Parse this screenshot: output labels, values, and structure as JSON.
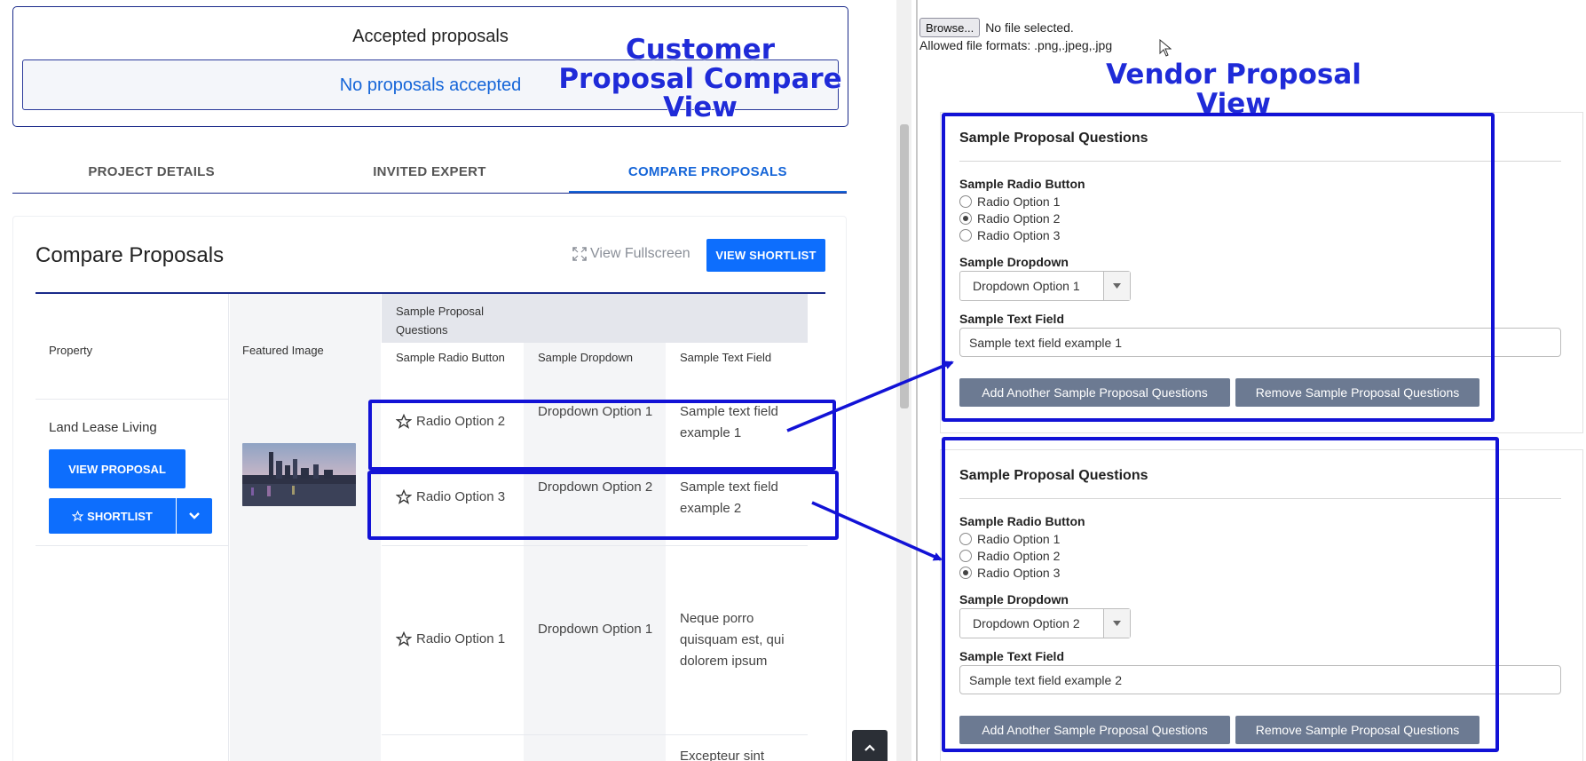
{
  "accepted": {
    "title": "Accepted proposals",
    "empty_message": "No proposals accepted"
  },
  "tabs": [
    {
      "label": "PROJECT DETAILS",
      "active": false
    },
    {
      "label": "INVITED EXPERT",
      "active": false
    },
    {
      "label": "COMPARE PROPOSALS",
      "active": true
    }
  ],
  "compare": {
    "title": "Compare Proposals",
    "view_fullscreen": "View Fullscreen",
    "view_shortlist": "VIEW SHORTLIST",
    "property_header": "Property",
    "featured_image_header": "Featured Image",
    "group_header": "Sample Proposal Questions",
    "question_headers": [
      "Sample Radio Button",
      "Sample Dropdown",
      "Sample Text Field"
    ],
    "property_name": "Land Lease Living",
    "view_proposal": "VIEW PROPOSAL",
    "shortlist": "SHORTLIST",
    "rows": [
      {
        "radio": "Radio Option 2",
        "dropdown": "Dropdown Option 1",
        "text": "Sample text field example 1"
      },
      {
        "radio": "Radio Option 3",
        "dropdown": "Dropdown Option 2",
        "text": "Sample text field example 2"
      },
      {
        "radio": "Radio Option 1",
        "dropdown": "Dropdown Option 1",
        "text": "Neque porro quisquam est, qui dolorem ipsum"
      },
      {
        "radio": "",
        "dropdown": "",
        "text": "Excepteur sint"
      }
    ]
  },
  "vendor": {
    "browse_button": "Browse...",
    "no_file": "No file selected.",
    "allowed_formats": "Allowed file formats: .png,.jpeg,.jpg",
    "blocks": [
      {
        "title": "Sample Proposal Questions",
        "radio_label": "Sample Radio Button",
        "radio_options": [
          "Radio Option 1",
          "Radio Option 2",
          "Radio Option 3"
        ],
        "radio_selected": "Radio Option 2",
        "dropdown_label": "Sample Dropdown",
        "dropdown_value": "Dropdown Option 1",
        "text_label": "Sample Text Field",
        "text_value": "Sample text field example 1",
        "add_button": "Add Another Sample Proposal Questions",
        "remove_button": "Remove Sample Proposal Questions"
      },
      {
        "title": "Sample Proposal Questions",
        "radio_label": "Sample Radio Button",
        "radio_options": [
          "Radio Option 1",
          "Radio Option 2",
          "Radio Option 3"
        ],
        "radio_selected": "Radio Option 3",
        "dropdown_label": "Sample Dropdown",
        "dropdown_value": "Dropdown Option 2",
        "text_label": "Sample Text Field",
        "text_value": "Sample text field example 2",
        "add_button": "Add Another Sample Proposal Questions",
        "remove_button": "Remove Sample Proposal Questions"
      }
    ]
  },
  "annotations": {
    "customer_view": "Customer Proposal Compare View",
    "vendor_view": "Vendor Proposal View"
  },
  "colors": {
    "primary_blue": "#0d6efd",
    "link_blue": "#1565d8",
    "annotation_blue": "#1212d6",
    "gray_button": "#6c7a92"
  }
}
